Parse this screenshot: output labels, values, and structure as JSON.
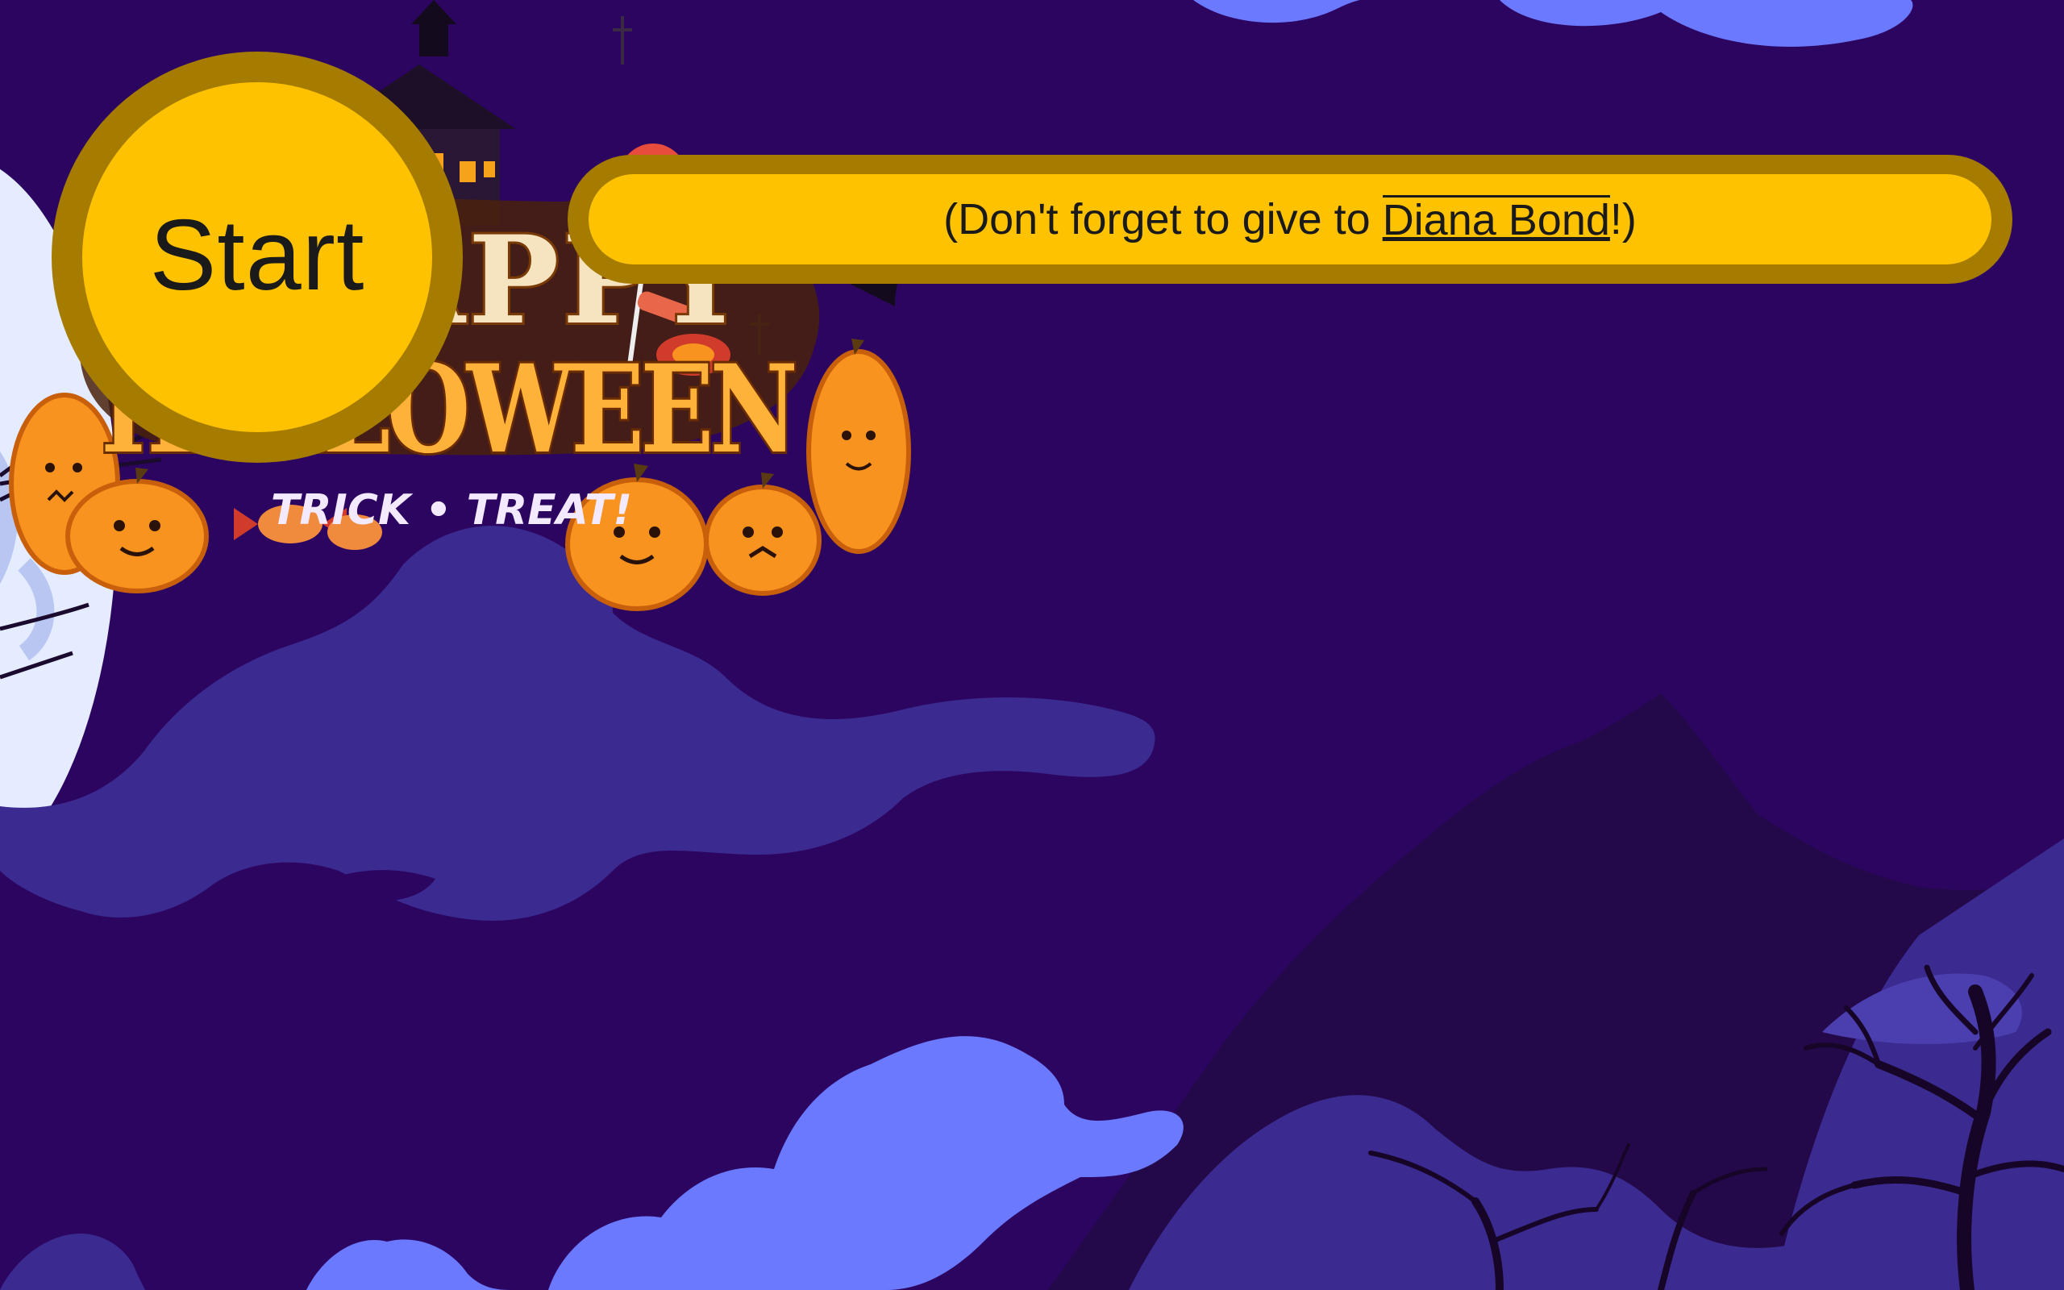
{
  "start_button": {
    "label": "Start"
  },
  "message": {
    "prefix": "(Don't forget to give to ",
    "name": "Diana Bond",
    "suffix": "!)"
  },
  "logo": {
    "line1": "HAPPY",
    "line2": "HALLOWEEN",
    "tagline": "TRICK • TREAT!"
  },
  "colors": {
    "sky": "#2c0561",
    "cloud_dark": "#3b2a8f",
    "cloud_light": "#6b79ff",
    "moon": "#e6ecff",
    "button_ring": "#a67c00",
    "button_fill": "#ffc200",
    "pumpkin": "#f7931e"
  },
  "icons": [
    "moon-icon",
    "pumpkin-icon",
    "bat-icon",
    "haunted-house-icon",
    "lollipop-icon",
    "candy-icon",
    "tree-icon"
  ]
}
